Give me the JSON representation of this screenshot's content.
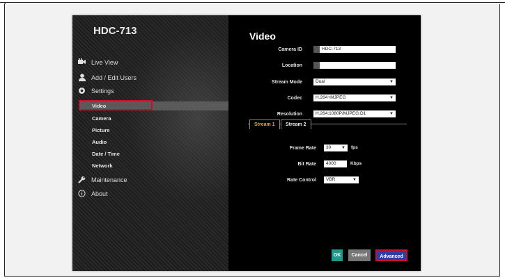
{
  "device": {
    "model": "HDC-713"
  },
  "nav": {
    "items": [
      {
        "label": "Live View",
        "icon": "video-camera-icon"
      },
      {
        "label": "Add / Edit Users",
        "icon": "user-icon"
      },
      {
        "label": "Settings",
        "icon": "gear-icon"
      }
    ],
    "settings_sub": [
      "Video",
      "Camera",
      "Picture",
      "Audio",
      "Date / Time",
      "Network"
    ],
    "bottom": [
      {
        "label": "Maintenance",
        "icon": "wrench-icon"
      },
      {
        "label": "About",
        "icon": "info-icon"
      }
    ],
    "selected": "Video"
  },
  "page": {
    "title": "Video",
    "camera_id": {
      "label": "Camera ID",
      "value": "HDC-713"
    },
    "location": {
      "label": "Location",
      "value": ""
    },
    "stream_mode": {
      "label": "Stream Mode",
      "value": "Dual"
    },
    "codec": {
      "label": "Codec",
      "value": "H.264+MJPEG"
    },
    "resolution": {
      "label": "Resolution",
      "value": "H.264:1080P/MJPEG:D1"
    }
  },
  "tabs": {
    "stream1": "Stream 1",
    "stream2": "Stream 2",
    "active": "Stream 1"
  },
  "stream": {
    "frame_rate": {
      "label": "Frame Rate",
      "value": "30",
      "unit": "fps"
    },
    "bit_rate": {
      "label": "Bit Rate",
      "value": "4000",
      "unit": "Kbps"
    },
    "rate_control": {
      "label": "Rate Control",
      "value": "VBR"
    }
  },
  "buttons": {
    "ok": "OK",
    "cancel": "Cancel",
    "advanced": "Advanced"
  },
  "colors": {
    "highlight_red": "#c8102e",
    "ok_teal": "#1f9a8a",
    "advanced_blue": "#2b3fa8",
    "active_tab": "#e8a33a"
  }
}
